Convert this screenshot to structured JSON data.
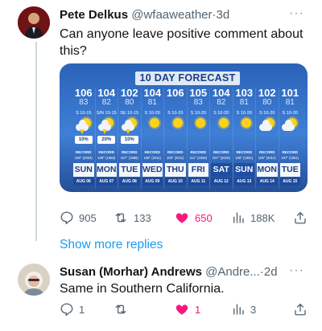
{
  "tweet": {
    "author_name": "Pete Delkus",
    "handle": "@wfaaweather",
    "separator": "·",
    "time": "3d",
    "more": "···",
    "text": "Can anyone leave positive comment about this?",
    "media": {
      "title": "10 DAY FORECAST",
      "days": [
        {
          "hi": "106",
          "lo": "83",
          "wind": "S 10-15",
          "pop": "10%",
          "record_label": "RECORD",
          "record": "109° (2003)",
          "day": "SUN",
          "date": "AUG 06",
          "icon": "sun-storm-icon"
        },
        {
          "hi": "104",
          "lo": "82",
          "wind": "S/N 10-15",
          "pop": "20%",
          "record_label": "RECORD",
          "record": "108° (1968)",
          "day": "MON",
          "date": "AUG 07",
          "icon": "sun-storm-icon"
        },
        {
          "hi": "102",
          "lo": "80",
          "wind": "SE 10-15",
          "pop": "10%",
          "record_label": "RECORD",
          "record": "107° (1988)",
          "day": "TUE",
          "date": "AUG 08",
          "icon": "sun-storm-icon"
        },
        {
          "hi": "104",
          "lo": "81",
          "wind": "S 10-20",
          "pop": "",
          "record_label": "RECORD",
          "record": "108° (2011)",
          "day": "WED",
          "date": "AUG 09",
          "icon": "sun-icon"
        },
        {
          "hi": "106",
          "lo": "",
          "wind": "S 10-20",
          "pop": "",
          "record_label": "RECORD",
          "record": "109° (2011)",
          "day": "THU",
          "date": "AUG 10",
          "icon": "sun-icon"
        },
        {
          "hi": "105",
          "lo": "83",
          "wind": "S 10-20",
          "pop": "",
          "record_label": "RECORD",
          "record": "112° (1936)",
          "day": "FRI",
          "date": "AUG 11",
          "icon": "sun-icon"
        },
        {
          "hi": "104",
          "lo": "82",
          "wind": "S 10-20",
          "pop": "",
          "record_label": "RECORD",
          "record": "107° (2016)",
          "day": "SAT",
          "date": "AUG 12",
          "icon": "sun-icon"
        },
        {
          "hi": "103",
          "lo": "81",
          "wind": "S 10-20",
          "pop": "",
          "record_label": "RECORD",
          "record": "105° (1951)",
          "day": "SUN",
          "date": "AUG 13",
          "icon": "sun-icon"
        },
        {
          "hi": "102",
          "lo": "80",
          "wind": "S 10-20",
          "pop": "",
          "record_label": "RECORD",
          "record": "106° (2012)",
          "day": "MON",
          "date": "AUG 14",
          "icon": "sun-cloud-icon"
        },
        {
          "hi": "101",
          "lo": "81",
          "wind": "S 10-20",
          "pop": "",
          "record_label": "RECORD",
          "record": "107° (1951)",
          "day": "TUE",
          "date": "AUG 15",
          "icon": "sun-cloud-icon"
        }
      ]
    },
    "actions": {
      "replies": "905",
      "retweets": "133",
      "likes": "650",
      "views": "188K"
    }
  },
  "show_more_replies": "Show more replies",
  "reply": {
    "author_name": "Susan (Morhar) Andrews",
    "handle": "@Andre...",
    "separator": "·",
    "time": "2d",
    "more": "···",
    "text": "Same in Southern California.",
    "actions": {
      "replies": "1",
      "retweets": "",
      "likes": "1",
      "views": "3"
    }
  },
  "colors": {
    "accent": "#1d9bf0",
    "like": "#f91880",
    "muted": "#536471"
  }
}
